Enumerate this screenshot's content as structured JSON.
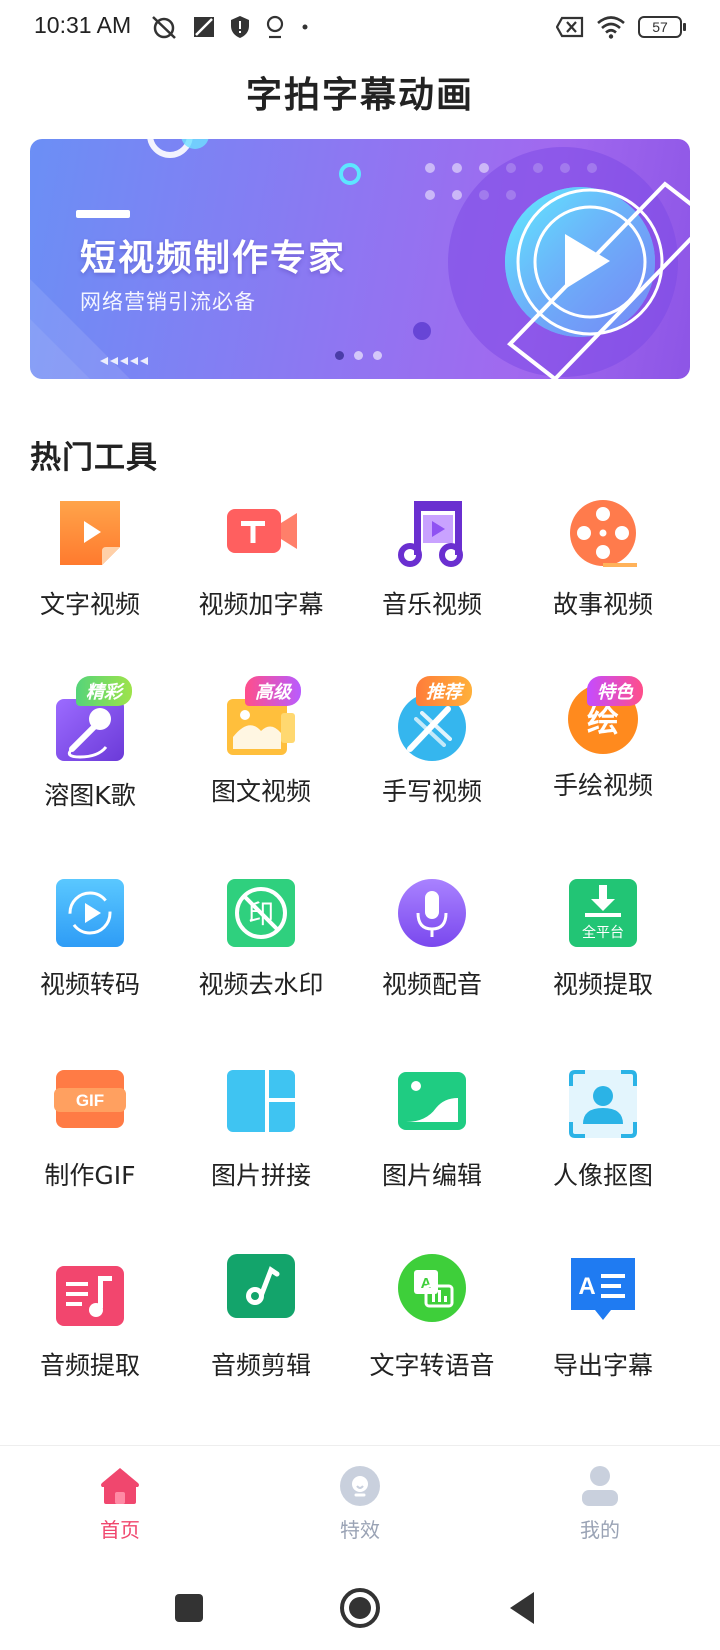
{
  "status_bar": {
    "time": "10:31 AM",
    "battery": "57"
  },
  "page_title": "字拍字幕动画",
  "banner": {
    "headline": "短视频制作专家",
    "subline": "网络营销引流必备"
  },
  "section_title": "热门工具",
  "tools": [
    {
      "label": "文字视频"
    },
    {
      "label": "视频加字幕"
    },
    {
      "label": "音乐视频"
    },
    {
      "label": "故事视频"
    },
    {
      "label": "溶图K歌",
      "badge": "精彩"
    },
    {
      "label": "图文视频",
      "badge": "高级"
    },
    {
      "label": "手写视频",
      "badge": "推荐"
    },
    {
      "label": "手绘视频",
      "badge": "特色"
    },
    {
      "label": "视频转码"
    },
    {
      "label": "视频去水印"
    },
    {
      "label": "视频配音"
    },
    {
      "label": "视频提取",
      "icon_text": "全平台"
    },
    {
      "label": "制作GIF",
      "icon_text": "GIF"
    },
    {
      "label": "图片拼接"
    },
    {
      "label": "图片编辑"
    },
    {
      "label": "人像抠图"
    },
    {
      "label": "音频提取"
    },
    {
      "label": "音频剪辑"
    },
    {
      "label": "文字转语音"
    },
    {
      "label": "导出字幕"
    }
  ],
  "icons": {
    "handdraw_glyph": "绘",
    "watermark_glyph": "印"
  },
  "bottom_nav": [
    {
      "label": "首页"
    },
    {
      "label": "特效"
    },
    {
      "label": "我的"
    }
  ],
  "colors": {
    "accent": "#f0476e",
    "nav_inactive": "#9aa3b5",
    "banner_start": "#6b8ff5",
    "banner_end": "#8d55e6"
  }
}
